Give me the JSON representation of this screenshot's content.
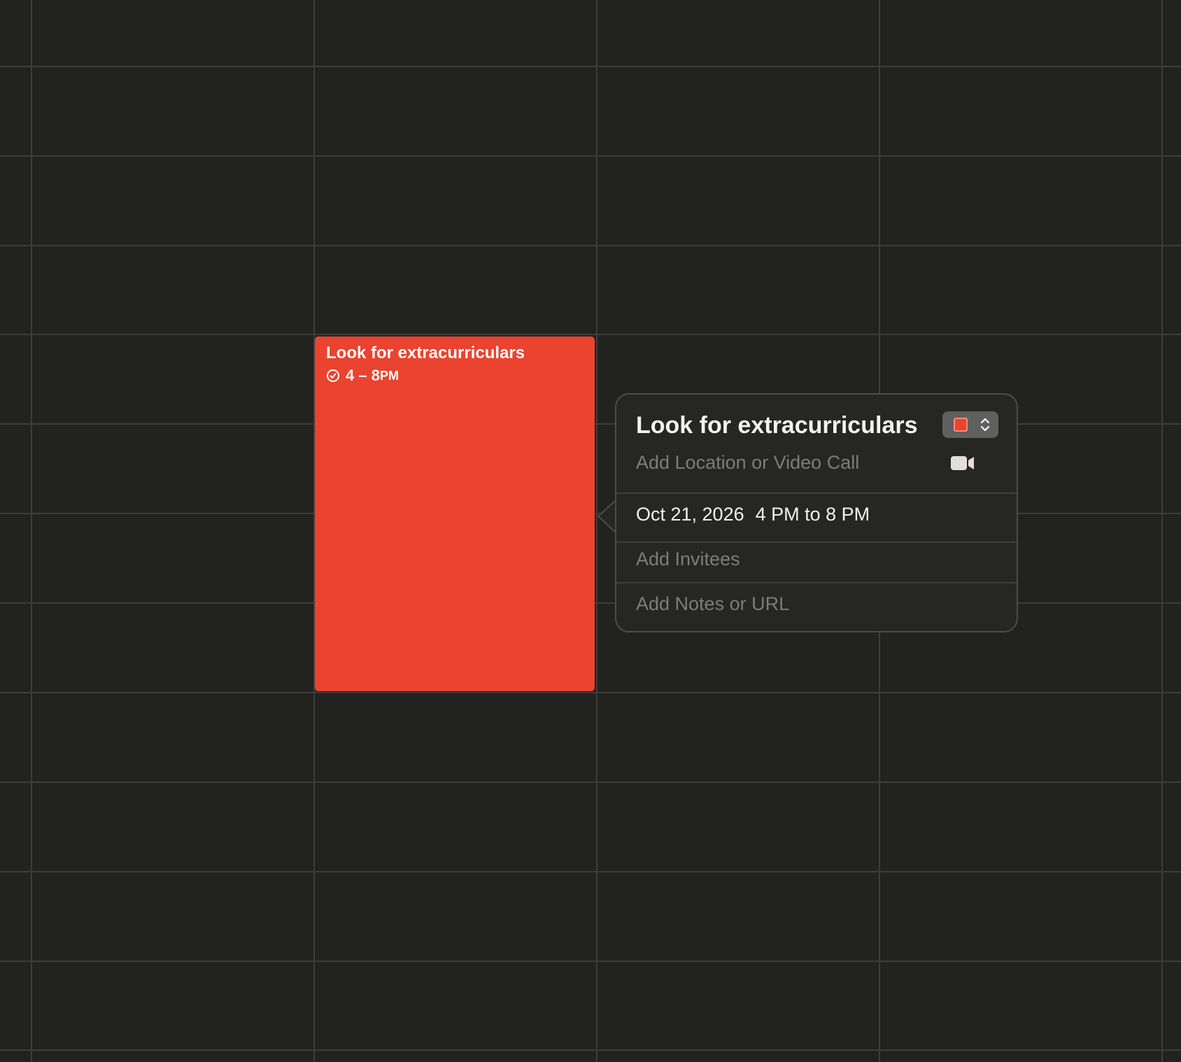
{
  "calendar": {
    "event": {
      "title": "Look for extracurriculars",
      "time_range": "4 – 8",
      "time_suffix": "PM",
      "color": "#ea432f"
    }
  },
  "popover": {
    "title": "Look for extracurriculars",
    "calendar_color": "#ea432f",
    "location_placeholder": "Add Location or Video Call",
    "date": "Oct 21, 2026",
    "time": "4 PM to 8 PM",
    "invitees_placeholder": "Add Invitees",
    "notes_placeholder": "Add Notes or URL",
    "icons": {
      "calendar_picker": "chevron-up-down-icon",
      "video_call": "video-camera-icon",
      "event_time": "clock-icon"
    }
  },
  "theme": {
    "background": "#222221",
    "gridline": "#3d3d3c",
    "popover_background": "#262625"
  }
}
